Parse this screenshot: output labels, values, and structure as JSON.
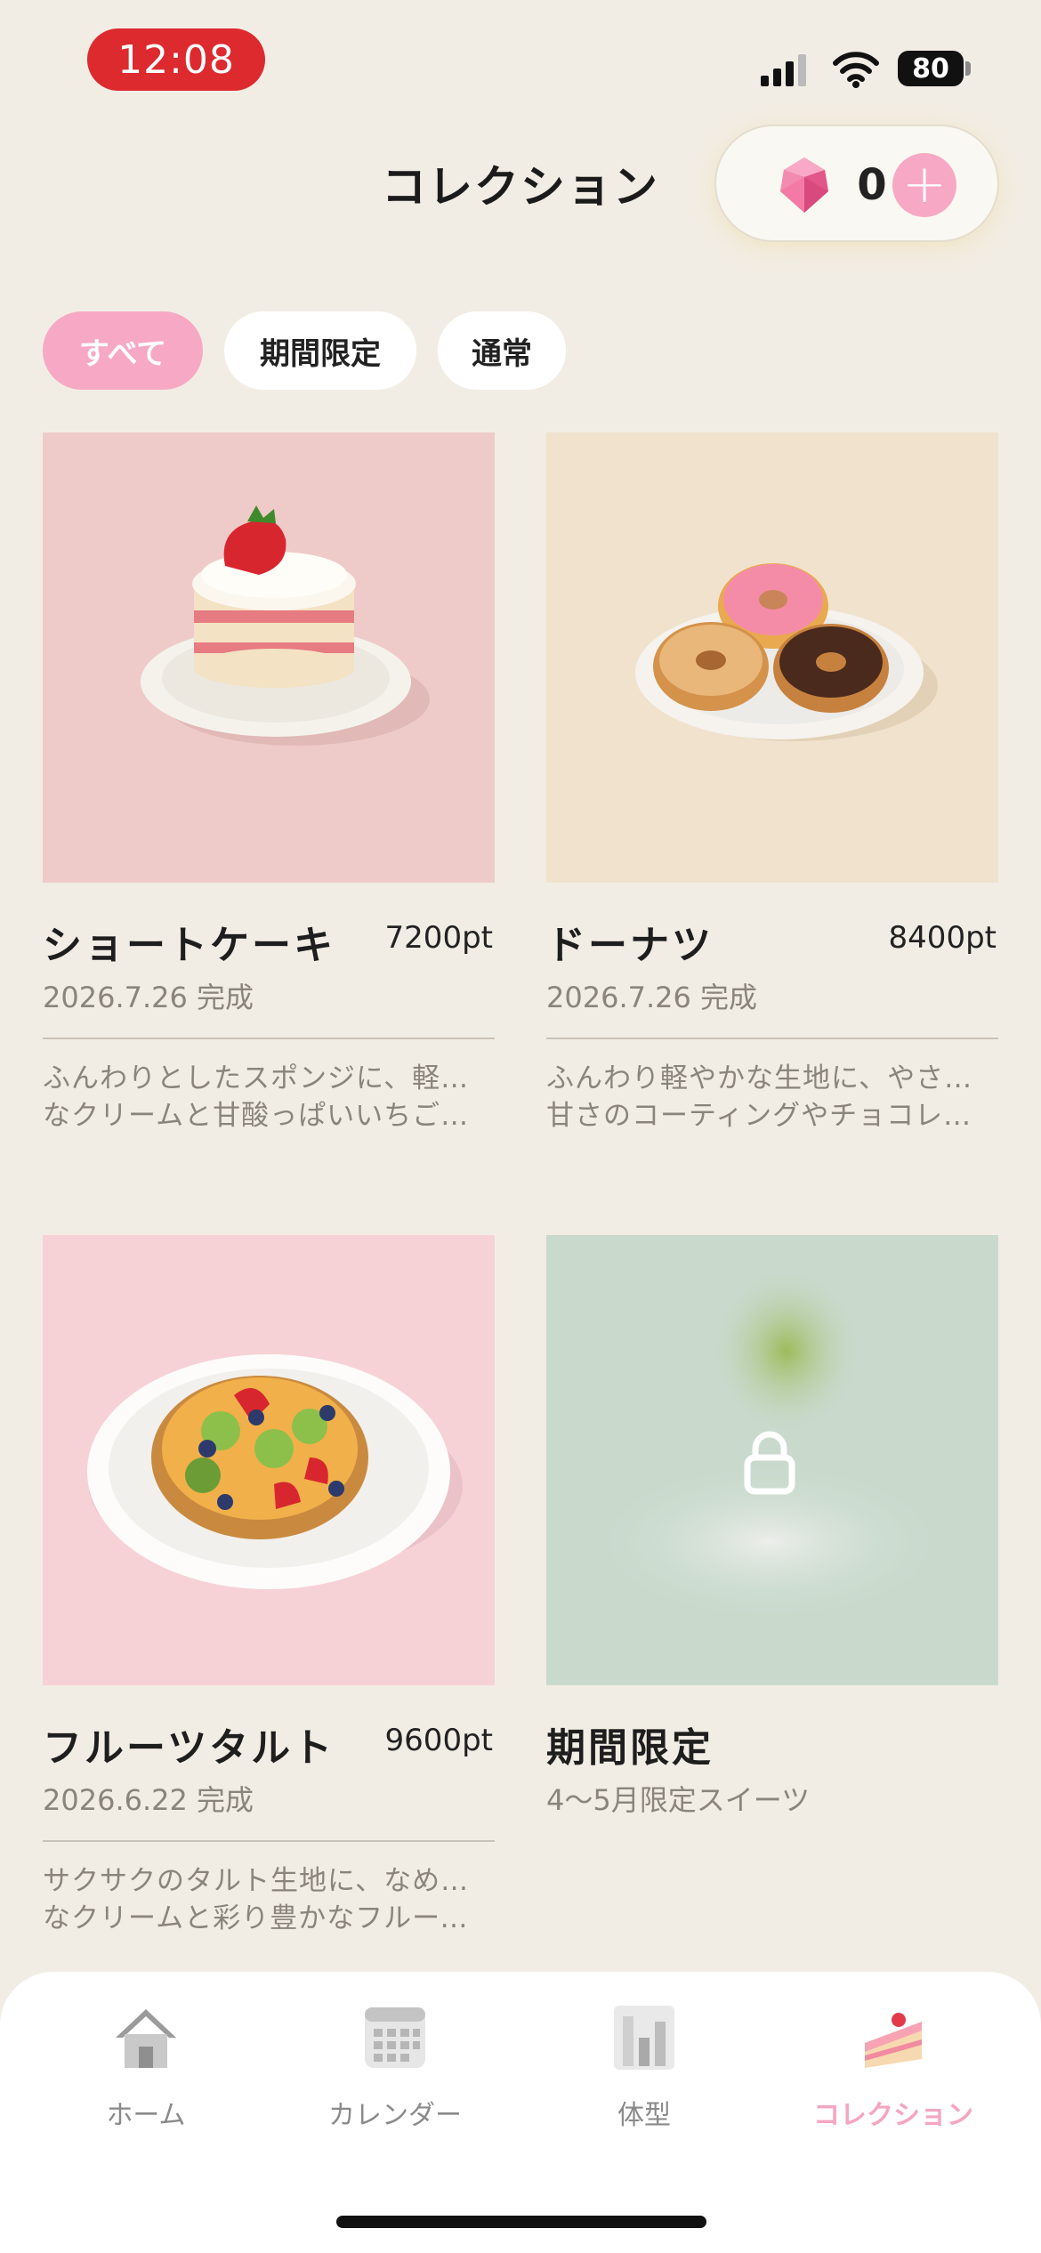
{
  "status_bar": {
    "time": "12:08",
    "battery": "80"
  },
  "header": {
    "title": "コレクション",
    "gem_count": "0",
    "add_label": "+"
  },
  "filters": [
    {
      "label": "すべて",
      "active": true
    },
    {
      "label": "期間限定",
      "active": false
    },
    {
      "label": "通常",
      "active": false
    }
  ],
  "cards": [
    {
      "name": "ショートケーキ",
      "points": "7200pt",
      "date": "2026.7.26 完成",
      "desc_line1": "ふんわりとしたスポンジに、軽やか",
      "desc_line2": "なクリームと甘酸っぱいいちごを…",
      "image": "strawberry-shortcake",
      "bg_color": "#eecbc9"
    },
    {
      "name": "ドーナツ",
      "points": "8400pt",
      "date": "2026.7.26 完成",
      "desc_line1": "ふんわり軽やかな生地に、やさしい",
      "desc_line2": "甘さのコーティングやチョコレー…",
      "image": "donuts",
      "bg_color": "#f0e2cd"
    },
    {
      "name": "フルーツタルト",
      "points": "9600pt",
      "date": "2026.6.22 完成",
      "desc_line1": "サクサクのタルト生地に、なめらか",
      "desc_line2": "なクリームと彩り豊かなフルーツ…",
      "image": "fruit-tart",
      "bg_color": "#f6d2d6"
    },
    {
      "name": "期間限定",
      "subtitle": "4〜5月限定スイーツ",
      "locked": true,
      "image": "locked-blurred",
      "bg_color": "#c9dacd"
    }
  ],
  "tabs": [
    {
      "label": "ホーム",
      "icon": "house-icon",
      "active": false
    },
    {
      "label": "カレンダー",
      "icon": "calendar-icon",
      "active": false
    },
    {
      "label": "体型",
      "icon": "chart-icon",
      "active": false
    },
    {
      "label": "コレクション",
      "icon": "cake-icon",
      "active": true
    }
  ],
  "colors": {
    "accent": "#f7a8c4",
    "background": "#f2ede4",
    "time_pill": "#dd2a2f"
  }
}
